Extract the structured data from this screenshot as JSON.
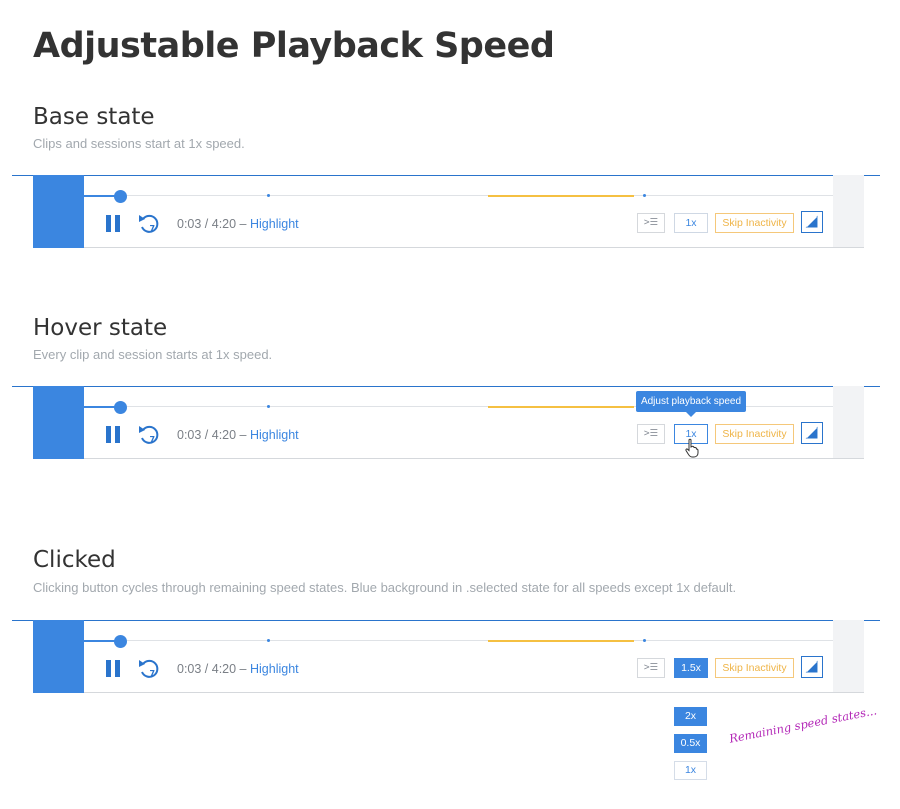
{
  "page": {
    "title": "Adjustable Playback Speed"
  },
  "sections": {
    "base": {
      "title": "Base state",
      "description": "Clips and sessions start at 1x speed."
    },
    "hover": {
      "title": "Hover state",
      "description": "Every clip and session starts at 1x speed.",
      "tooltip": "Adjust playback speed"
    },
    "clicked": {
      "title": "Clicked",
      "description": "Clicking button cycles through remaining speed states. Blue background in .selected state for all speeds except 1x default.",
      "speed_options": [
        "2x",
        "0.5x",
        "1x"
      ],
      "annotation": "Remaining speed states..."
    }
  },
  "player": {
    "time": "0:03 / 4:20",
    "separator": " – ",
    "highlight": "Highlight",
    "events_button": ">☰",
    "skip_label": "Skip Inactivity",
    "progress_fraction": 0.05
  },
  "speeds": {
    "base": "1x",
    "hover": "1x",
    "clicked": "1.5x"
  },
  "colors": {
    "accent": "#3b86e0",
    "accent_dark": "#2a74cc",
    "inactivity": "#f5c042",
    "annotation": "#b42ab8"
  },
  "icons": {
    "play_state": "pause-icon",
    "rewind": "rewind-7-icon",
    "expand": "expand-icon",
    "cursor": "hand-pointer-icon"
  }
}
